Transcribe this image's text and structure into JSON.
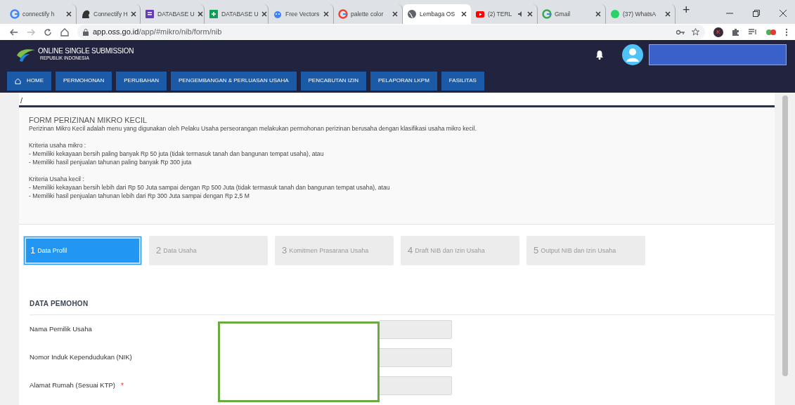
{
  "browser": {
    "tabs": [
      {
        "title": "connectify h",
        "selected": false,
        "muted": false
      },
      {
        "title": "Connectify H",
        "selected": false,
        "muted": false
      },
      {
        "title": "DATABASE U",
        "selected": false,
        "muted": false
      },
      {
        "title": "DATABASE U",
        "selected": false,
        "muted": false
      },
      {
        "title": "Free Vectors",
        "selected": false,
        "muted": false
      },
      {
        "title": "palette color",
        "selected": false,
        "muted": false
      },
      {
        "title": "Lembaga OS",
        "selected": true,
        "muted": false
      },
      {
        "title": "(2) TERL",
        "selected": false,
        "muted": true
      },
      {
        "title": "Gmail",
        "selected": false,
        "muted": false
      },
      {
        "title": "(37) WhatsA",
        "selected": false,
        "muted": false
      }
    ],
    "new_tab": "+",
    "url": {
      "host": "app.oss.go.id",
      "path": "/app/#mikro/nib/form/nib"
    },
    "profile_initial": "K"
  },
  "header": {
    "brand": "ONLINE SINGLE SUBMISSION",
    "subtitle": "REPUBLIK INDONESIA"
  },
  "nav": [
    {
      "label": "HOME",
      "kind": "home"
    },
    {
      "label": "PERMOHONAN",
      "kind": "plain"
    },
    {
      "label": "PERUBAHAN",
      "kind": "plain"
    },
    {
      "label": "PENGEMBANGAN & PERLUASAN USAHA",
      "kind": "plain"
    },
    {
      "label": "PENCABUTAN IZIN",
      "kind": "plain"
    },
    {
      "label": "PELAPORAN LKPM",
      "kind": "plain"
    },
    {
      "label": "FASILITAS",
      "kind": "plain"
    }
  ],
  "breadcrumb": "/",
  "intro": {
    "title": "FORM PERIZINAN MIKRO KECIL",
    "description": "Perizinan Mikro Kecil adalah menu yang digunakan oleh Pelaku Usaha perseorangan melakukan permohonan perizinan berusaha dengan klasifikasi usaha mikro kecil.",
    "sections": [
      {
        "heading": "Kriteria usaha mikro :",
        "items": [
          "- Memiliki kekayaan bersih paling banyak Rp 50 juta (tidak termasuk tanah dan bangunan tempat usaha), atau",
          "- Memiliki hasil penjualan tahunan paling banyak Rp 300 juta"
        ]
      },
      {
        "heading": "Kriteria Usaha kecil :",
        "items": [
          "- Memiliki kekayaan bersih lebih dari Rp 50 Juta sampai dengan Rp 500 Juta (tidak termasuk tanah dan bangunan tempat usaha), atau",
          "- Memiliki hasil penjualan tahunan lebih dari Rp 300 Juta sampai dengan Rp 2,5 M"
        ]
      }
    ]
  },
  "steps": [
    {
      "number": "1",
      "label": "Data Profil",
      "selected": true
    },
    {
      "number": "2",
      "label": "Data Usaha",
      "selected": false
    },
    {
      "number": "3",
      "label": "Komitmen Prasarana Usaha",
      "selected": false
    },
    {
      "number": "4",
      "label": "Draft NIB dan Izin Usaha",
      "selected": false
    },
    {
      "number": "5",
      "label": "Output NIB dan Izin Usaha",
      "selected": false
    }
  ],
  "form": {
    "section": "DATA PEMOHON",
    "fields": [
      {
        "label": "Nama Pemilik Usaha",
        "required": false
      },
      {
        "label": "Nomor Induk Kependudukan (NIK)",
        "required": false
      },
      {
        "label": "Alamat Rumah (Sesuai KTP)",
        "required": true
      }
    ],
    "required_mark": "*"
  }
}
